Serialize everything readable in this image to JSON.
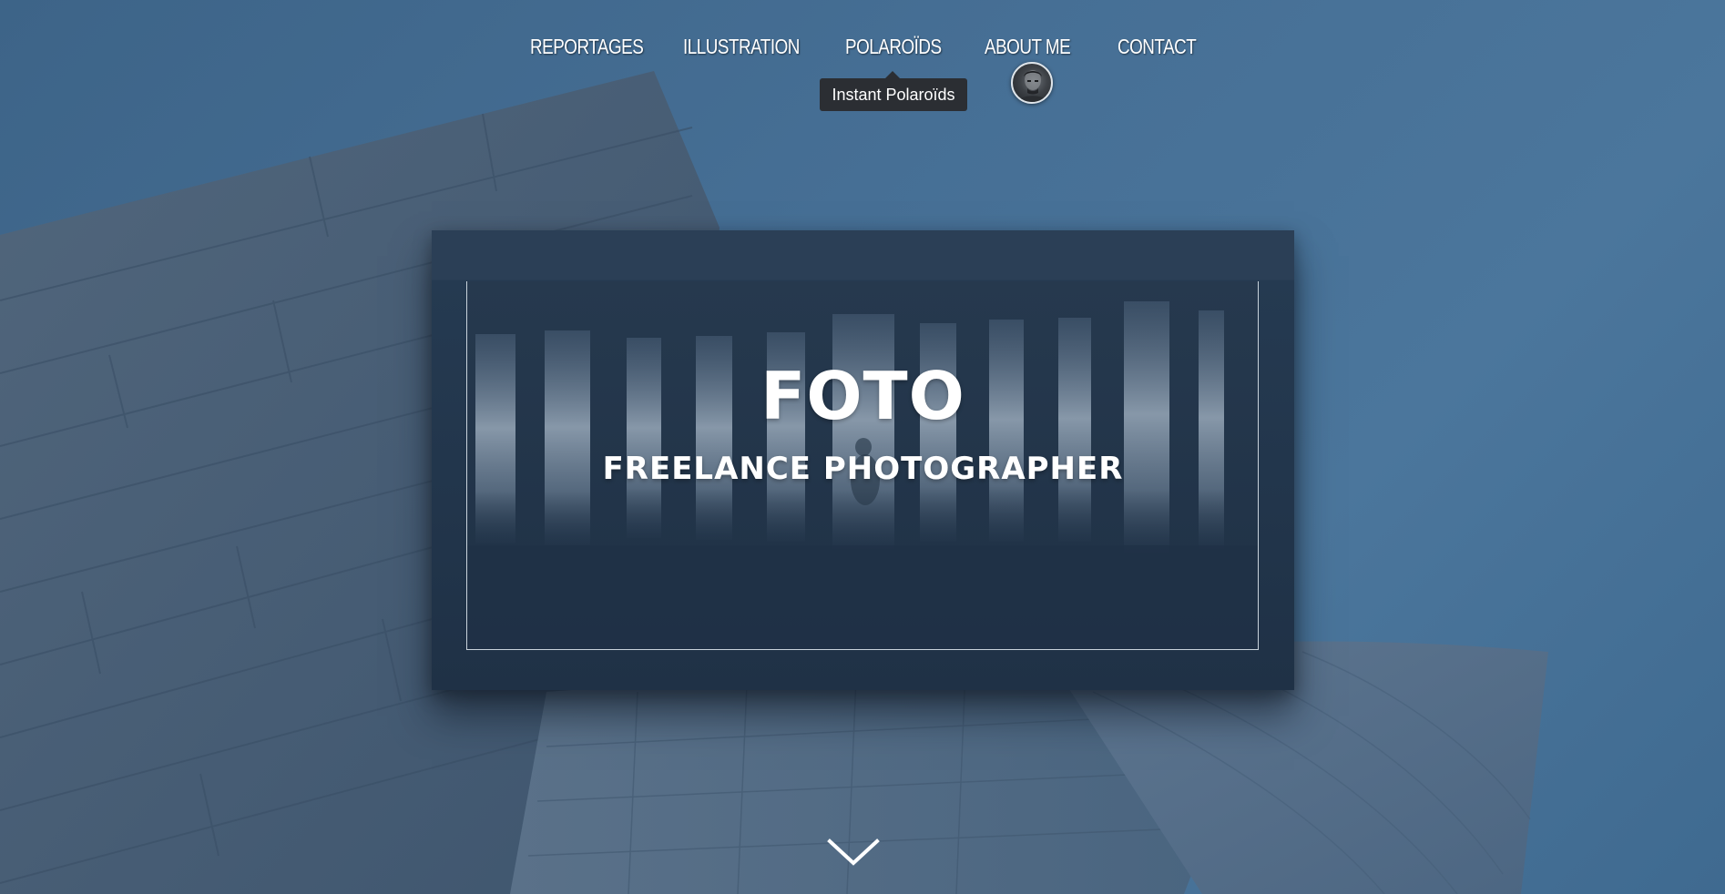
{
  "nav": {
    "items": [
      {
        "label": "REPORTAGES"
      },
      {
        "label": "ILLUSTRATION"
      },
      {
        "label": "POLAROÏDS"
      },
      {
        "label": "ABOUT ME"
      },
      {
        "label": "CONTACT"
      }
    ],
    "tooltip": "Instant Polaroïds"
  },
  "hero": {
    "title": "FOTO",
    "subtitle": "FREELANCE PHOTOGRAPHER"
  },
  "icons": {
    "scroll": "chevron-down-icon",
    "avatar": "avatar"
  },
  "colors": {
    "background": "#466f95",
    "card": "#253a51",
    "card_top": "#2b3f56",
    "tooltip": "#2b2e33",
    "text": "#ffffff"
  }
}
